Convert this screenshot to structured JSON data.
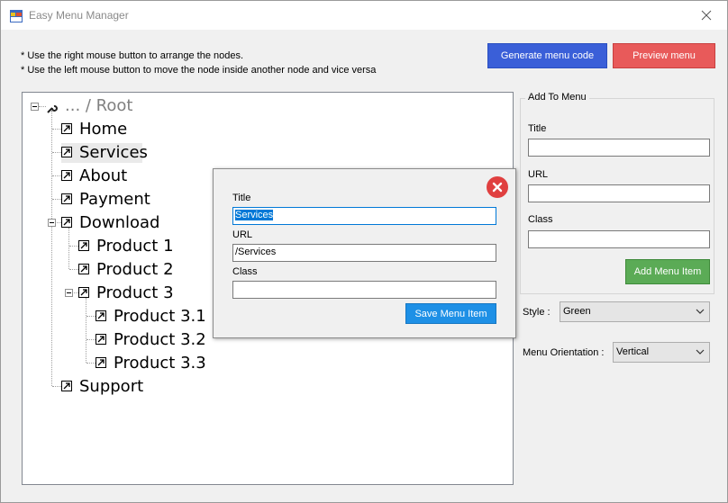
{
  "window": {
    "title": "Easy Menu Manager"
  },
  "instructions": [
    "* Use the right mouse button to arrange the nodes.",
    "* Use the left mouse button to move the node inside another node and vice versa"
  ],
  "toolbar": {
    "generate_label": "Generate menu code",
    "preview_label": "Preview menu"
  },
  "tree": {
    "root": "... / Root",
    "nodes": [
      "Home",
      "Services",
      "About",
      "Payment",
      "Download",
      "Product 1",
      "Product 2",
      "Product 3",
      "Product 3.1",
      "Product 3.2",
      "Product 3.3",
      "Support"
    ],
    "selected": "Services"
  },
  "dialog": {
    "title_label": "Title",
    "title_value": "Services",
    "url_label": "URL",
    "url_value": "/Services",
    "class_label": "Class",
    "class_value": "",
    "save_label": "Save Menu Item"
  },
  "add_panel": {
    "legend": "Add To Menu",
    "title_label": "Title",
    "url_label": "URL",
    "class_label": "Class",
    "add_label": "Add Menu Item"
  },
  "style": {
    "label": "Style :",
    "value": "Green"
  },
  "orientation": {
    "label": "Menu Orientation :",
    "value": "Vertical"
  },
  "colors": {
    "generate": "#3a5fd8",
    "preview": "#e85a5a",
    "add": "#5bab56",
    "save": "#1e90e6"
  }
}
